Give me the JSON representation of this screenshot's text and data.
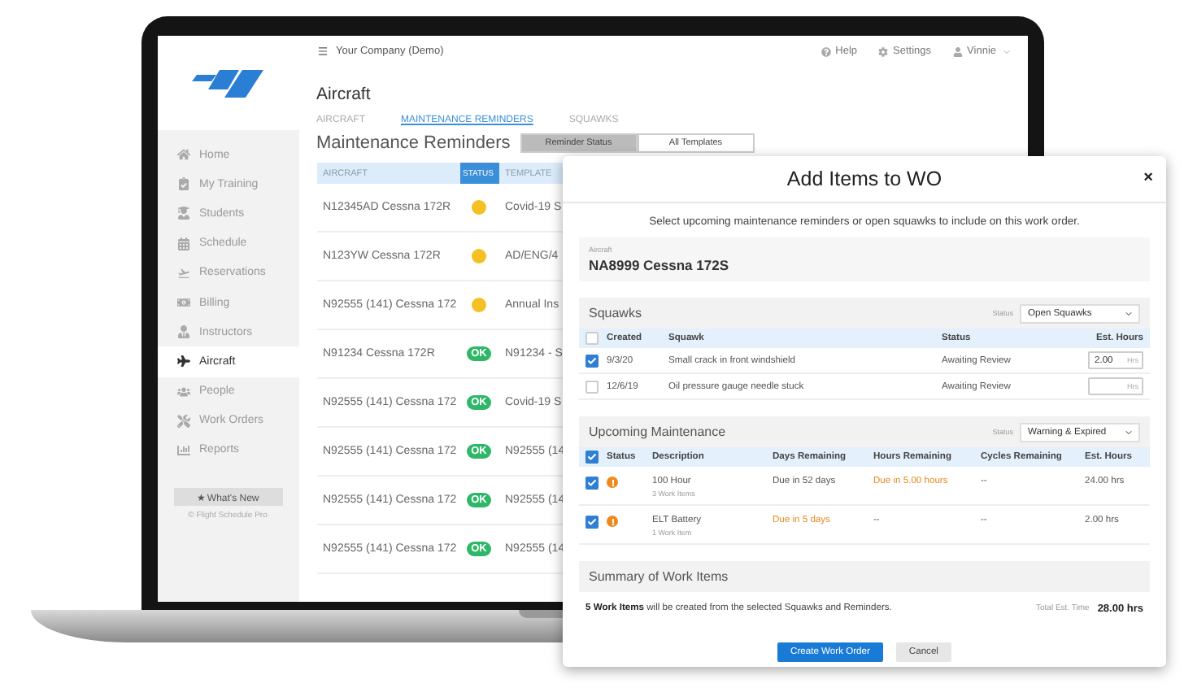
{
  "laptop_screen": {
    "topbar": {
      "company": "Your Company (Demo)",
      "links": [
        "Help",
        "Settings"
      ],
      "user": "Vinnie"
    },
    "sidebar": {
      "items": [
        {
          "label": "Home",
          "selected": false
        },
        {
          "label": "My Training",
          "selected": false
        },
        {
          "label": "Students",
          "selected": false
        },
        {
          "label": "Schedule",
          "selected": false
        },
        {
          "label": "Reservations",
          "selected": false
        },
        {
          "label": "Billing",
          "selected": false
        },
        {
          "label": "Instructors",
          "selected": false
        },
        {
          "label": "Aircraft",
          "selected": true
        },
        {
          "label": "People",
          "selected": false
        },
        {
          "label": "Work Orders",
          "selected": false
        },
        {
          "label": "Reports",
          "selected": false
        }
      ],
      "whats_new": "★ What's New",
      "footer": "© Flight Schedule Pro"
    },
    "page_title": "Aircraft",
    "tabs": [
      {
        "label": "AIRCRAFT",
        "selected": false
      },
      {
        "label": "MAINTENANCE REMINDERS",
        "selected": true
      },
      {
        "label": "SQUAWKS",
        "selected": false
      }
    ],
    "section_title": "Maintenance Reminders",
    "view_toggle": [
      {
        "label": "Reminder Status",
        "selected": true
      },
      {
        "label": "All Templates",
        "selected": false
      }
    ],
    "table": {
      "columns": [
        {
          "label": "AIRCRAFT",
          "sorted": false
        },
        {
          "label": "STATUS",
          "sorted": true
        },
        {
          "label": "TEMPLATE",
          "sorted": false
        }
      ],
      "rows": [
        {
          "aircraft": "N12345AD Cessna 172R",
          "status": {
            "kind": "warning"
          },
          "template": "Covid-19 S"
        },
        {
          "aircraft": "N123YW Cessna 172R",
          "status": {
            "kind": "warning"
          },
          "template": "AD/ENG/4"
        },
        {
          "aircraft": "N92555 (141) Cessna 172",
          "status": {
            "kind": "warning"
          },
          "template": "Annual Ins"
        },
        {
          "aircraft": "N91234 Cessna 172R",
          "status": {
            "kind": "ok",
            "label": "OK"
          },
          "template": "N91234 - S"
        },
        {
          "aircraft": "N92555 (141) Cessna 172",
          "status": {
            "kind": "ok",
            "label": "OK"
          },
          "template": "Covid-19 S"
        },
        {
          "aircraft": "N92555 (141) Cessna 172",
          "status": {
            "kind": "ok",
            "label": "OK"
          },
          "template": "N92555 (14"
        },
        {
          "aircraft": "N92555 (141) Cessna 172",
          "status": {
            "kind": "ok",
            "label": "OK"
          },
          "template": "N92555 (14"
        },
        {
          "aircraft": "N92555 (141) Cessna 172",
          "status": {
            "kind": "ok",
            "label": "OK"
          },
          "template": "N92555 (14"
        }
      ]
    }
  },
  "modal": {
    "title": "Add Items to WO",
    "close": "×",
    "instructions": "Select upcoming maintenance reminders or open squawks to include on this work order.",
    "aircraft": {
      "label": "Aircraft",
      "value": "NA8999 Cessna 172S"
    },
    "squawks": {
      "title": "Squawks",
      "filter": {
        "label": "Status",
        "value": "Open Squawks"
      },
      "all_checked": false,
      "columns": [
        "Created",
        "Squawk",
        "Status",
        "Est. Hours"
      ],
      "rows": [
        {
          "checked": true,
          "created": "9/3/20",
          "squawk": "Small crack in front windshield",
          "status": "Awaiting Review",
          "est_hours": "2.00",
          "unit": "Hrs"
        },
        {
          "checked": false,
          "created": "12/6/19",
          "squawk": "Oil pressure gauge needle stuck",
          "status": "Awaiting Review",
          "unit": "Hrs"
        }
      ]
    },
    "maintenance": {
      "title": "Upcoming Maintenance",
      "filter": {
        "label": "Status",
        "value": "Warning & Expired"
      },
      "all_checked": true,
      "columns": [
        "Status",
        "Description",
        "Days Remaining",
        "Hours Remaining",
        "Cycles Remaining",
        "Est. Hours"
      ],
      "rows": [
        {
          "checked": true,
          "status": {
            "kind": "warning"
          },
          "description": "100 Hour",
          "work_items": "3 Work Items",
          "days_remaining": {
            "text": "Due in 52 days",
            "warning": false
          },
          "hours_remaining": {
            "text": "Due in 5.00 hours",
            "warning": true
          },
          "cycles_remaining": {
            "text": "--",
            "warning": false
          },
          "est_hours": "24.00 hrs"
        },
        {
          "checked": true,
          "status": {
            "kind": "warning"
          },
          "description": "ELT Battery",
          "work_items": "1 Work Item",
          "days_remaining": {
            "text": "Due in 5 days",
            "warning": true
          },
          "hours_remaining": {
            "text": "--",
            "warning": false
          },
          "cycles_remaining": {
            "text": "--",
            "warning": false
          },
          "est_hours": "2.00 hrs"
        }
      ]
    },
    "summary": {
      "title": "Summary of Work Items",
      "message": "**5 Work Items** will be created from the selected Squawks and Reminders.",
      "total_label": "Total Est. Time",
      "total": "28.00 hrs"
    },
    "buttons": [
      {
        "label": "Create Work Order",
        "kind": "primary"
      },
      {
        "label": "Cancel",
        "kind": "secondary"
      }
    ]
  }
}
